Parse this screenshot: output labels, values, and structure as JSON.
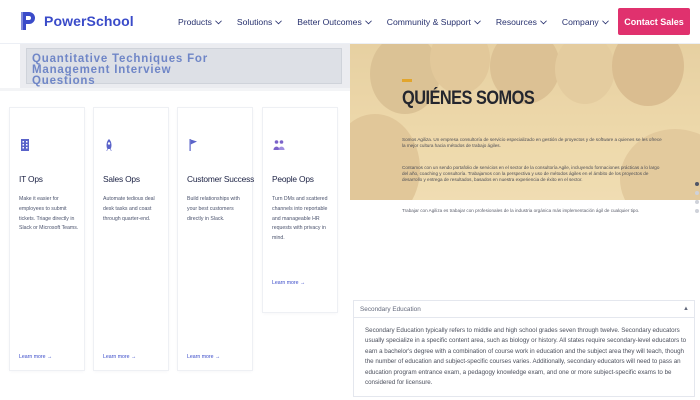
{
  "header": {
    "brand": "PowerSchool",
    "nav": [
      {
        "label": "Products"
      },
      {
        "label": "Solutions"
      },
      {
        "label": "Better Outcomes"
      },
      {
        "label": "Community & Support"
      },
      {
        "label": "Resources"
      },
      {
        "label": "Company"
      }
    ],
    "cta": "Contact Sales"
  },
  "banner": {
    "lines": [
      "Quantitative Techniques For",
      "Management Interview",
      "Questions"
    ]
  },
  "cards": [
    {
      "icon": "building-icon",
      "title": "IT Ops",
      "desc": "Make it easier for employees to submit tickets. Triage directly in Slack or Microsoft Teams.",
      "link": "Learn more →"
    },
    {
      "icon": "rocket-icon",
      "title": "Sales Ops",
      "desc": "Automate tedious deal desk tasks and coast through quarter-end.",
      "link": "Learn more →"
    },
    {
      "icon": "flag-icon",
      "title": "Customer Success",
      "desc": "Build relationships with your best customers directly in Slack.",
      "link": "Learn more →"
    },
    {
      "icon": "people-icon",
      "title": "People Ops",
      "desc": "Turn DMs and scattered channels into reportable and manageable HR requests with privacy in mind.",
      "link": "Learn more →"
    }
  ],
  "hero": {
    "title": "QUIÉNES SOMOS",
    "paragraphs": [
      "Somos Agiliza. Un empresa consultoría de servicio especializado en gestión de proyectos y de software a quienes se les ofrece la mejor cultura hacia métodos de trabajo ágiles.",
      "Contamos con un sendo portafolio de servicios en el sector de la consultoría Agile, incluyendo formaciones prácticas a lo largo del año, coaching y consultoría. Trabajamos con la perspectiva y uso de métodos ágiles en el ámbito de los proyectos de desarrollo y entrega de resultados, basados en nuestra experiencia de éxito en el sector.",
      "Trabajar con Agiliza es trabajar con profesionales de la industria orgánica más implementación ágil de cualquier tipo."
    ],
    "slider_dots": 4,
    "active_dot": 0
  },
  "accordion": {
    "title": "Secondary Education",
    "caret": "▲",
    "body": "Secondary Education typically refers to middle and high school grades seven through twelve. Secondary educators usually specialize in a specific content area, such as biology or history. All states require secondary-level educators to earn a bachelor's degree with a combination of course work in education and the subject area they will teach, though the number of education and subject-specific courses varies. Additionally, secondary educators will need to pass an education program entrance exam, a pedagogy knowledge exam, and one or more subject-specific exams to be considered for licensure."
  },
  "colors": {
    "brand": "#3a4bc9",
    "cta": "#e0316e",
    "nav_text": "#27316e",
    "hero_bg": "#e7cd98",
    "accent": "#e2a52c"
  }
}
